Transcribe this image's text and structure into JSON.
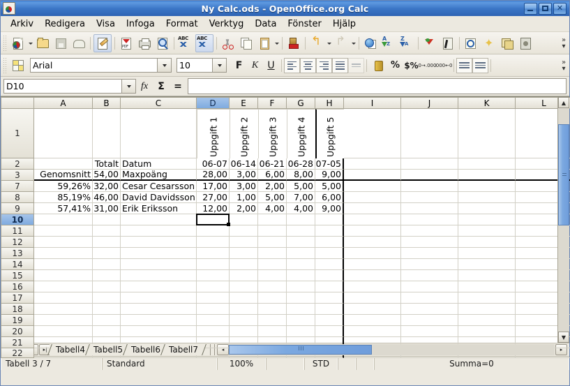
{
  "window": {
    "title": "Ny Calc.ods - OpenOffice.org Calc",
    "app_icon": "calc-document-icon",
    "buttons": {
      "minimize": "–",
      "maximize": "□",
      "close": "✕"
    }
  },
  "menubar": {
    "items": [
      {
        "label": "Arkiv",
        "accel": "A"
      },
      {
        "label": "Redigera",
        "accel": "R"
      },
      {
        "label": "Visa",
        "accel": "s"
      },
      {
        "label": "Infoga",
        "accel": "I"
      },
      {
        "label": "Format",
        "accel": "o"
      },
      {
        "label": "Verktyg",
        "accel": "V"
      },
      {
        "label": "Data",
        "accel": "a"
      },
      {
        "label": "Fönster",
        "accel": "F"
      },
      {
        "label": "Hjälp",
        "accel": "H"
      }
    ]
  },
  "standard_toolbar": {
    "overflow_label": "»",
    "items": [
      {
        "name": "new-document-icon"
      },
      {
        "name": "new-document-dropdown-icon"
      },
      {
        "name": "open-document-icon"
      },
      {
        "name": "save-document-icon"
      },
      {
        "name": "send-email-icon"
      },
      {
        "name": "edit-file-icon",
        "selected": true
      },
      {
        "name": "export-pdf-icon"
      },
      {
        "name": "print-file-icon"
      },
      {
        "name": "print-preview-icon"
      },
      {
        "name": "spelling-check-icon"
      },
      {
        "name": "autospellcheck-icon",
        "selected": true
      },
      {
        "name": "cut-icon"
      },
      {
        "name": "copy-icon"
      },
      {
        "name": "paste-icon"
      },
      {
        "name": "paste-dropdown-icon"
      },
      {
        "name": "clone-formatting-icon"
      },
      {
        "name": "undo-icon"
      },
      {
        "name": "undo-dropdown-icon"
      },
      {
        "name": "redo-icon"
      },
      {
        "name": "redo-dropdown-icon"
      },
      {
        "name": "hyperlink-icon"
      },
      {
        "name": "sort-ascending-icon"
      },
      {
        "name": "sort-descending-icon"
      },
      {
        "name": "autofilter-icon"
      },
      {
        "name": "draw-functions-icon"
      },
      {
        "name": "find-replace-icon"
      },
      {
        "name": "gallery-icon"
      },
      {
        "name": "navigator-icon"
      },
      {
        "name": "data-sources-icon"
      }
    ]
  },
  "formatting_toolbar": {
    "overflow_label": "»",
    "styles_icon": "styles-and-formatting-icon",
    "font_name": "Arial",
    "font_size": "10",
    "bold_label": "F",
    "italic_label": "K",
    "underline_label": "U",
    "currency_icon": "currency-format-icon",
    "percent_label": "%",
    "standard_label": "$%",
    "add_decimal_label": "0→.000",
    "del_decimal_label": ".000←0",
    "decrease_indent_icon": "decrease-indent-icon",
    "increase_indent_icon": "increase-indent-icon"
  },
  "formula_bar": {
    "name_box": "D10",
    "function_wizard_label": "fx",
    "sum_label": "Σ",
    "equals_label": "=",
    "input_value": "",
    "input_placeholder": ""
  },
  "sheet": {
    "columns": [
      {
        "label": "A",
        "width": 84
      },
      {
        "label": "B",
        "width": 40
      },
      {
        "label": "C",
        "width": 109
      },
      {
        "label": "D",
        "width": 47,
        "selected": true
      },
      {
        "label": "E",
        "width": 41
      },
      {
        "label": "F",
        "width": 41
      },
      {
        "label": "G",
        "width": 41
      },
      {
        "label": "H",
        "width": 41
      },
      {
        "label": "I",
        "width": 82
      },
      {
        "label": "J",
        "width": 82
      },
      {
        "label": "K",
        "width": 82
      },
      {
        "label": "L",
        "width": 82
      }
    ],
    "rows": [
      {
        "label": "1",
        "height": 71
      },
      {
        "label": "2",
        "height": 16
      },
      {
        "label": "3",
        "height": 16
      },
      {
        "label": "7",
        "height": 16
      },
      {
        "label": "8",
        "height": 16
      },
      {
        "label": "9",
        "height": 16
      },
      {
        "label": "10",
        "height": 16,
        "selected": true
      },
      {
        "label": "11",
        "height": 16
      },
      {
        "label": "12",
        "height": 16
      },
      {
        "label": "13",
        "height": 16
      },
      {
        "label": "14",
        "height": 16
      },
      {
        "label": "15",
        "height": 16
      },
      {
        "label": "16",
        "height": 16
      },
      {
        "label": "17",
        "height": 16
      },
      {
        "label": "18",
        "height": 16
      },
      {
        "label": "19",
        "height": 16
      },
      {
        "label": "20",
        "height": 16
      },
      {
        "label": "21",
        "height": 16
      },
      {
        "label": "22",
        "height": 14
      }
    ],
    "cells": [
      [
        "",
        "",
        "",
        "Uppgift 1",
        "Uppgift 2",
        "Uppgift 3",
        "Uppgift 4",
        "Uppgift 5",
        "",
        "",
        "",
        ""
      ],
      [
        "",
        "Totalt",
        "Datum",
        "06-07",
        "06-14",
        "06-21",
        "06-28",
        "07-05",
        "",
        "",
        "",
        ""
      ],
      [
        "Genomsnitt",
        "54,00",
        "Maxpoäng",
        "28,00",
        "3,00",
        "6,00",
        "8,00",
        "9,00",
        "",
        "",
        "",
        ""
      ],
      [
        "59,26%",
        "32,00",
        "Cesar Cesarsson",
        "17,00",
        "3,00",
        "2,00",
        "5,00",
        "5,00",
        "",
        "",
        "",
        ""
      ],
      [
        "85,19%",
        "46,00",
        "David Davidsson",
        "27,00",
        "1,00",
        "5,00",
        "7,00",
        "6,00",
        "",
        "",
        "",
        ""
      ],
      [
        "57,41%",
        "31,00",
        "Erik Eriksson",
        "12,00",
        "2,00",
        "4,00",
        "4,00",
        "9,00",
        "",
        "",
        "",
        ""
      ],
      [
        "",
        "",
        "",
        "",
        "",
        "",
        "",
        "",
        "",
        "",
        "",
        ""
      ],
      [
        "",
        "",
        "",
        "",
        "",
        "",
        "",
        "",
        "",
        "",
        "",
        ""
      ],
      [
        "",
        "",
        "",
        "",
        "",
        "",
        "",
        "",
        "",
        "",
        "",
        ""
      ],
      [
        "",
        "",
        "",
        "",
        "",
        "",
        "",
        "",
        "",
        "",
        "",
        ""
      ],
      [
        "",
        "",
        "",
        "",
        "",
        "",
        "",
        "",
        "",
        "",
        "",
        ""
      ],
      [
        "",
        "",
        "",
        "",
        "",
        "",
        "",
        "",
        "",
        "",
        "",
        ""
      ],
      [
        "",
        "",
        "",
        "",
        "",
        "",
        "",
        "",
        "",
        "",
        "",
        ""
      ],
      [
        "",
        "",
        "",
        "",
        "",
        "",
        "",
        "",
        "",
        "",
        "",
        ""
      ],
      [
        "",
        "",
        "",
        "",
        "",
        "",
        "",
        "",
        "",
        "",
        "",
        ""
      ],
      [
        "",
        "",
        "",
        "",
        "",
        "",
        "",
        "",
        "",
        "",
        "",
        ""
      ],
      [
        "",
        "",
        "",
        "",
        "",
        "",
        "",
        "",
        "",
        "",
        "",
        ""
      ],
      [
        "",
        "",
        "",
        "",
        "",
        "",
        "",
        "",
        "",
        "",
        "",
        ""
      ],
      [
        "",
        "",
        "",
        "",
        "",
        "",
        "",
        "",
        "",
        "",
        "",
        ""
      ]
    ],
    "active_cell": "D10",
    "scrollbars": {
      "v_up": "▲",
      "v_down": "▼",
      "h_left": "◂",
      "h_right": "▸"
    }
  },
  "sheet_tabs": {
    "nav_first": "|◂",
    "nav_prev": "◂",
    "nav_next": "▸",
    "nav_last": "▸|",
    "tabs": [
      {
        "label": "Tabell4",
        "active": false
      },
      {
        "label": "Tabell5",
        "active": false
      },
      {
        "label": "Tabell6",
        "active": false
      },
      {
        "label": "Tabell7",
        "active": false
      }
    ]
  },
  "status_bar": {
    "sheet_position": "Tabell 3 / 7",
    "page_style": "Standard",
    "zoom": "100%",
    "insert_mode": "",
    "selection_mode": "STD",
    "modified": "",
    "signature": "",
    "sum": "Summa=0"
  }
}
